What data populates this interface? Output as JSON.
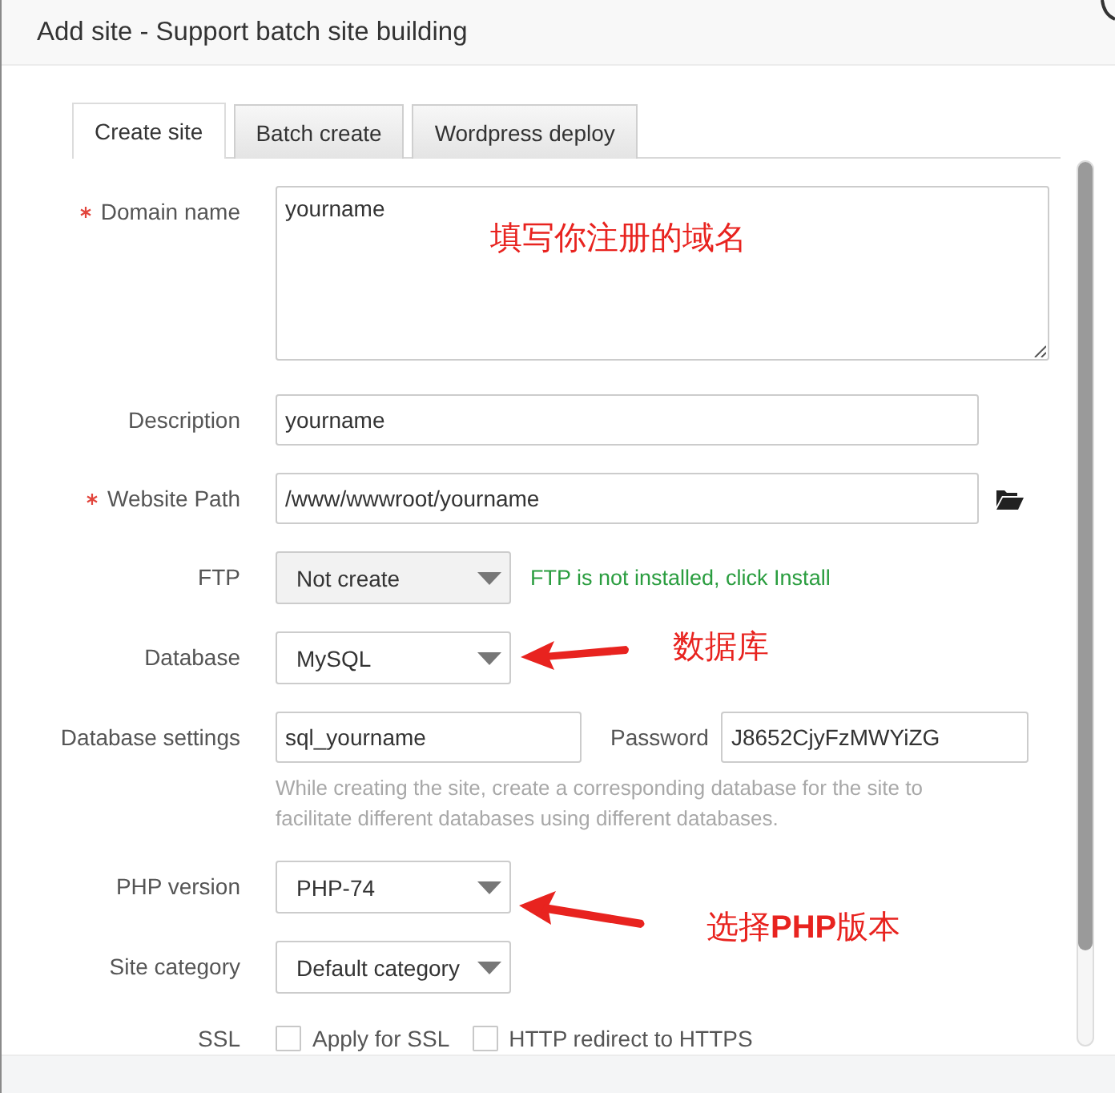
{
  "window": {
    "title": "Add site - Support batch site building"
  },
  "tabs": [
    {
      "label": "Create site",
      "selected": true
    },
    {
      "label": "Batch create",
      "selected": false
    },
    {
      "label": "Wordpress deploy",
      "selected": false
    }
  ],
  "form": {
    "fields": [
      {
        "kind": "textarea",
        "label": "Domain name",
        "required": true,
        "value": "yourname",
        "annotation": {
          "kind": "inside",
          "text": "填写你注册的域名"
        }
      },
      {
        "kind": "text",
        "label": "Description",
        "required": false,
        "value": "yourname"
      },
      {
        "kind": "path",
        "label": "Website Path",
        "required": true,
        "value": "/www/wwwroot/yourname"
      },
      {
        "kind": "select",
        "label": "FTP",
        "required": false,
        "value": "Not create",
        "disabled": true,
        "note": "FTP is not installed, click Install"
      },
      {
        "kind": "select",
        "label": "Database",
        "required": false,
        "value": "MySQL",
        "disabled": false,
        "annotation": {
          "kind": "level",
          "text": "数据库"
        }
      },
      {
        "kind": "database",
        "label": "Database settings",
        "required": false,
        "value": "sql_yourname",
        "password_label": "Password",
        "password": "J8652CjyFzMWYiZG",
        "hint": "While creating the site, create a corresponding database for the site to facilitate different databases using different databases."
      },
      {
        "kind": "select",
        "label": "PHP version",
        "required": false,
        "value": "PHP-74",
        "disabled": false,
        "annotation": {
          "kind": "sloped",
          "text": "选择**PHP**版本"
        }
      },
      {
        "kind": "select",
        "label": "Site category",
        "required": false,
        "value": "Default category",
        "disabled": false
      },
      {
        "kind": "checkboxes",
        "label": "SSL",
        "required": false,
        "options": [
          {
            "label": "Apply for SSL",
            "checked": false
          },
          {
            "label": "HTTP redirect to HTTPS",
            "checked": false
          }
        ]
      }
    ]
  }
}
